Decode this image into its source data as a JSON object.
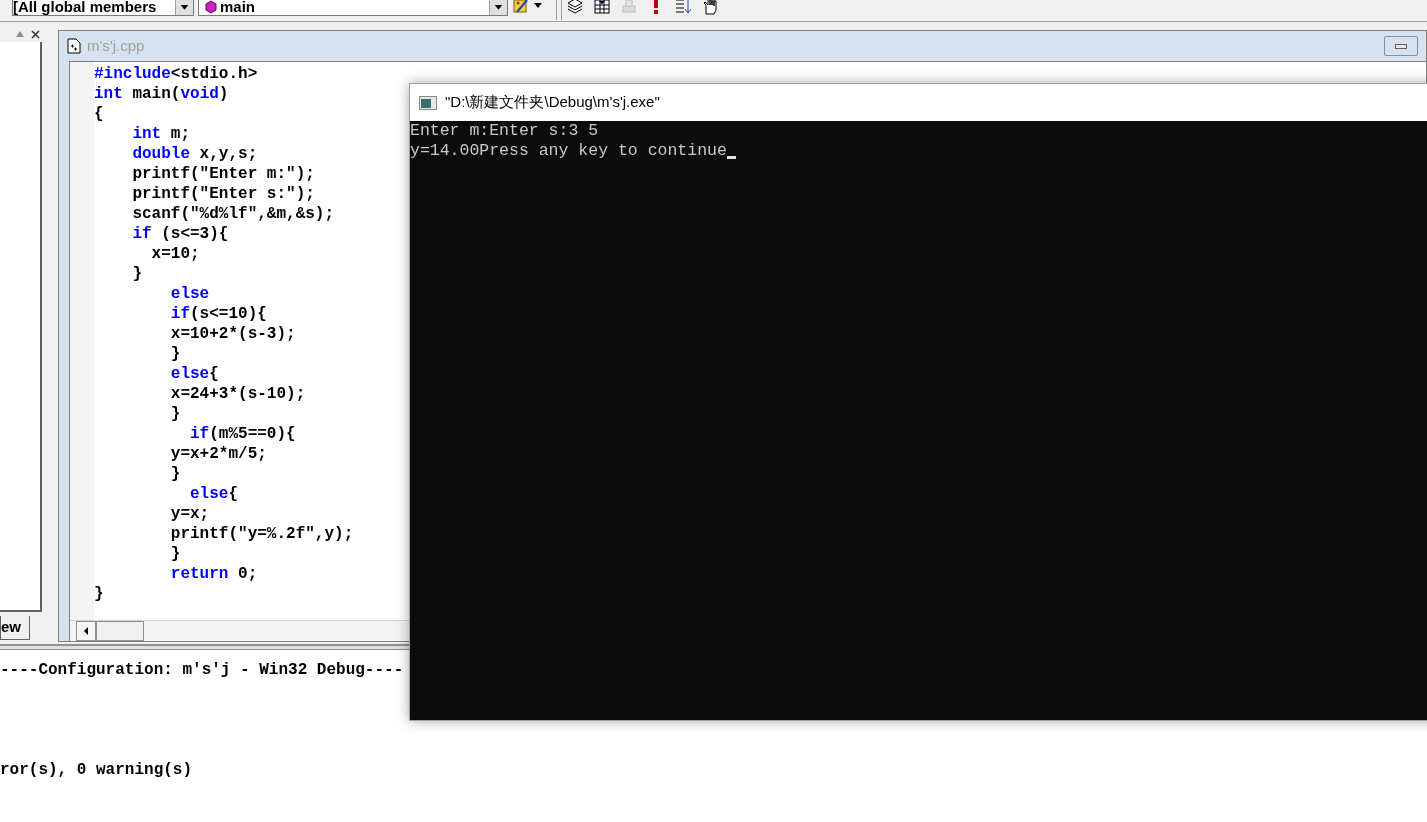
{
  "toolbar": {
    "scope_combo": {
      "value": "[All global members"
    },
    "function_combo": {
      "value": "main"
    }
  },
  "workspace": {
    "tab_label": "ew"
  },
  "editor": {
    "title": "m's'j.cpp",
    "active": false,
    "lines": [
      [
        {
          "t": "#include",
          "kind": "keyword"
        },
        {
          "t": "<stdio.h>",
          "kind": "plain"
        }
      ],
      [
        {
          "t": "int",
          "kind": "keyword"
        },
        {
          "t": " main(",
          "kind": "plain"
        },
        {
          "t": "void",
          "kind": "keyword"
        },
        {
          "t": ")",
          "kind": "plain"
        }
      ],
      [
        {
          "t": "{",
          "kind": "plain"
        }
      ],
      [
        {
          "t": "    int",
          "kind": "keyword"
        },
        {
          "t": " m;",
          "kind": "plain"
        }
      ],
      [
        {
          "t": "    double",
          "kind": "keyword"
        },
        {
          "t": " x,y,s;",
          "kind": "plain"
        }
      ],
      [
        {
          "t": "    printf(\"Enter m:\");",
          "kind": "plain"
        }
      ],
      [
        {
          "t": "    printf(\"Enter s:\");",
          "kind": "plain"
        }
      ],
      [
        {
          "t": "    scanf(\"%d%lf\",&m,&s);",
          "kind": "plain"
        }
      ],
      [
        {
          "t": "    if",
          "kind": "keyword"
        },
        {
          "t": " (s<=3){",
          "kind": "plain"
        }
      ],
      [
        {
          "t": "      x=10;",
          "kind": "plain"
        }
      ],
      [
        {
          "t": "    }",
          "kind": "plain"
        }
      ],
      [
        {
          "t": "        else",
          "kind": "keyword"
        }
      ],
      [
        {
          "t": "        if",
          "kind": "keyword"
        },
        {
          "t": "(s<=10){",
          "kind": "plain"
        }
      ],
      [
        {
          "t": "        x=10+2*(s-3);",
          "kind": "plain"
        }
      ],
      [
        {
          "t": "        }",
          "kind": "plain"
        }
      ],
      [
        {
          "t": "        else",
          "kind": "keyword"
        },
        {
          "t": "{",
          "kind": "plain"
        }
      ],
      [
        {
          "t": "        x=24+3*(s-10);",
          "kind": "plain"
        }
      ],
      [
        {
          "t": "        }",
          "kind": "plain"
        }
      ],
      [
        {
          "t": "          if",
          "kind": "keyword"
        },
        {
          "t": "(m%5==0){",
          "kind": "plain"
        }
      ],
      [
        {
          "t": "        y=x+2*m/5;",
          "kind": "plain"
        }
      ],
      [
        {
          "t": "        }",
          "kind": "plain"
        }
      ],
      [
        {
          "t": "          else",
          "kind": "keyword"
        },
        {
          "t": "{",
          "kind": "plain"
        }
      ],
      [
        {
          "t": "        y=x;",
          "kind": "plain"
        }
      ],
      [
        {
          "t": "        printf(\"y=%.2f\",y);",
          "kind": "plain"
        }
      ],
      [
        {
          "t": "        }",
          "kind": "plain"
        }
      ],
      [
        {
          "t": "        return",
          "kind": "keyword"
        },
        {
          "t": " 0;",
          "kind": "plain"
        }
      ],
      [
        {
          "t": "}",
          "kind": "plain"
        }
      ]
    ]
  },
  "output": {
    "config_line": "----Configuration: m's'j - Win32 Debug----",
    "result_line": "ror(s), 0 warning(s)"
  },
  "console": {
    "title": "\"D:\\新建文件夹\\Debug\\m's'j.exe\"",
    "lines": [
      "Enter m:Enter s:3 5",
      "y=14.00Press any key to continue"
    ]
  }
}
